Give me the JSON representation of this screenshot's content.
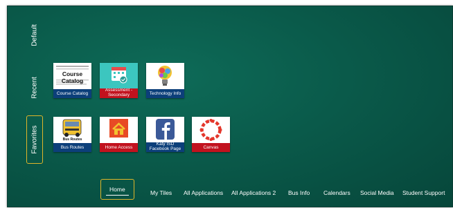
{
  "side_tabs": {
    "default": "Default",
    "recent": "Recent",
    "favorites": "Favorites"
  },
  "recent_tiles": [
    {
      "caption": "Course Catalog",
      "image_text": "Course Catalog",
      "caption_color": "#0c3f7a"
    },
    {
      "caption": "Assessment - Secondary",
      "caption_color": "#c2121e"
    },
    {
      "caption": "Technology Info",
      "caption_color": "#0c3f7a"
    }
  ],
  "favorite_tiles": [
    {
      "caption": "Bus Routes",
      "image_text": "Bus Routes",
      "caption_color": "#0c3f7a"
    },
    {
      "caption": "Home Access",
      "caption_color": "#c2121e"
    },
    {
      "caption": "Katy ISD Facebook Page",
      "caption_color": "#0c3f7a"
    },
    {
      "caption": "Canvas",
      "caption_color": "#c2121e"
    }
  ],
  "nav": {
    "items": [
      "Home",
      "My Tiles",
      "All Applications",
      "All Applications 2",
      "Bus Info",
      "Calendars",
      "Social Media",
      "Student Support"
    ],
    "selected": "Home"
  },
  "colors": {
    "background": "#0a5a4a",
    "selected_outline": "#e0b62a",
    "caption_blue": "#0c3f7a",
    "caption_red": "#c2121e"
  }
}
